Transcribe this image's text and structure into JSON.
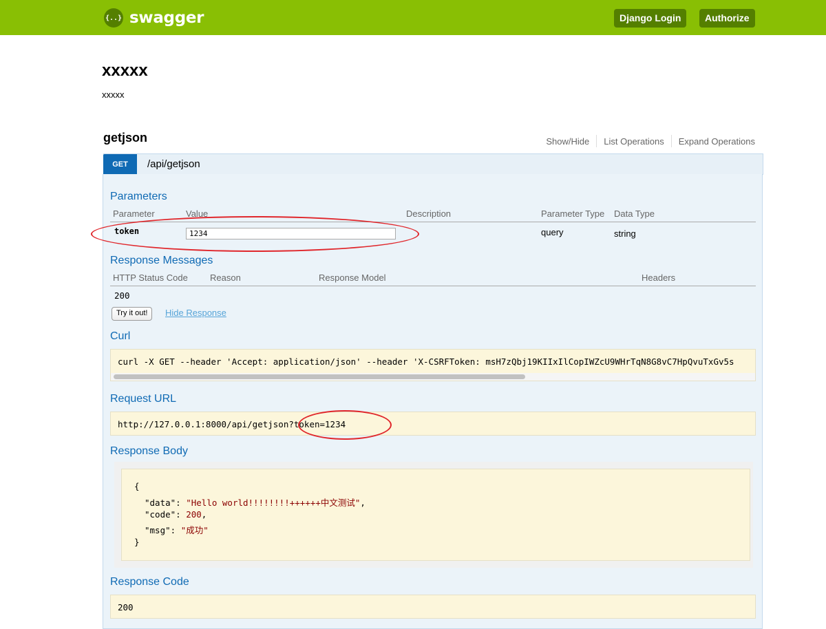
{
  "header": {
    "logo_icon": "{..}",
    "logo_text": "swagger",
    "django_login": "Django Login",
    "authorize": "Authorize"
  },
  "info": {
    "title": "xxxxx",
    "description": "xxxxx"
  },
  "resource": {
    "name": "getjson",
    "ops": {
      "show_hide": "Show/Hide",
      "list": "List Operations",
      "expand": "Expand Operations"
    }
  },
  "operation": {
    "method": "GET",
    "path": "/api/getjson",
    "parameters": {
      "title": "Parameters",
      "headers": [
        "Parameter",
        "Value",
        "Description",
        "Parameter Type",
        "Data Type"
      ],
      "rows": [
        {
          "name": "token",
          "value": "1234",
          "description": "",
          "param_type": "query",
          "data_type": "string"
        }
      ]
    },
    "response_messages": {
      "title": "Response Messages",
      "headers": [
        "HTTP Status Code",
        "Reason",
        "Response Model",
        "Headers"
      ],
      "rows": [
        {
          "code": "200"
        }
      ]
    },
    "try_button": "Try it out!",
    "hide_response": "Hide Response",
    "curl": {
      "title": "Curl",
      "command": "curl -X GET --header 'Accept: application/json' --header 'X-CSRFToken: msH7zQbj19KIIxIlCopIWZcU9WHrTqN8G8vC7HpQvuTxGv5s"
    },
    "request_url": {
      "title": "Request URL",
      "url": "http://127.0.0.1:8000/api/getjson?token=1234"
    },
    "response_body": {
      "title": "Response Body",
      "lines": {
        "open": "{",
        "data_key": "\"data\"",
        "data_value": "\"Hello world!!!!!!!!++++++中文测试\"",
        "code_key": "\"code\"",
        "code_value": "200",
        "msg_key": "\"msg\"",
        "msg_value": "\"成功\"",
        "close": "}"
      }
    },
    "response_code": {
      "title": "Response Code",
      "value": "200"
    }
  },
  "colors": {
    "topbar": "#89bf04",
    "topbar_button": "#547f00",
    "get_method": "#0f6ab4",
    "annotation": "#e0262b"
  }
}
